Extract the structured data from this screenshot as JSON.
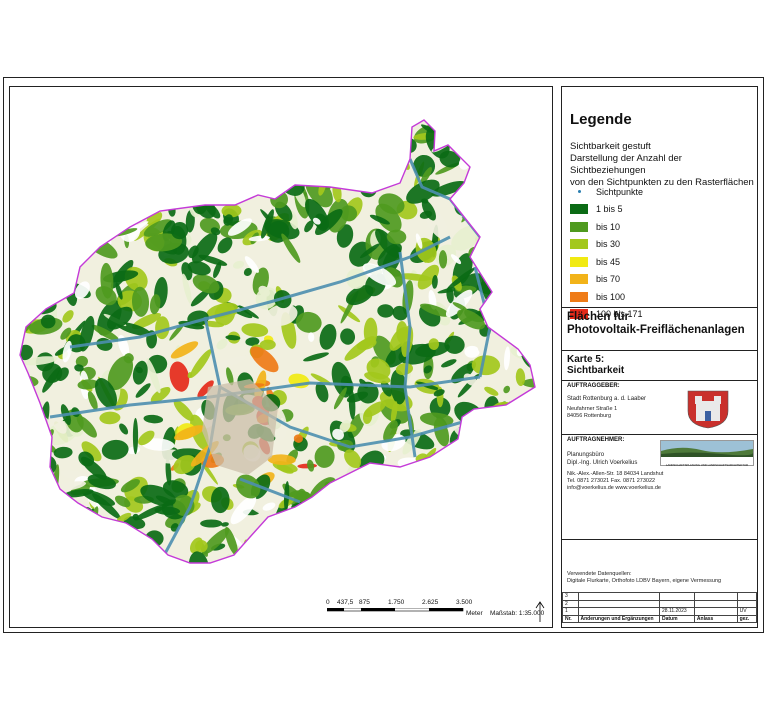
{
  "legend": {
    "title": "Legende",
    "subtitle_1": "Sichtbarkeit gestuft",
    "subtitle_2": "Darstellung der Anzahl der Sichtbeziehungen",
    "subtitle_3": "von den Sichtpunkten zu den Rasterflächen",
    "points_label": "Sichtpunkte",
    "classes": [
      {
        "label": "1 bis 5",
        "color": "#0b6b15"
      },
      {
        "label": "bis 10",
        "color": "#4f9a1f"
      },
      {
        "label": "bis 30",
        "color": "#a3c81c"
      },
      {
        "label": "bis 45",
        "color": "#f1ea12"
      },
      {
        "label": "bis 70",
        "color": "#f2b319"
      },
      {
        "label": "bis 100",
        "color": "#ef7b17"
      },
      {
        "label": "100 bis 171",
        "color": "#e52a1a"
      }
    ]
  },
  "project": {
    "title_1": "Flächen für",
    "title_2": "Photovoltaik-Freiflächenanlagen"
  },
  "map_sheet": {
    "number": "Karte 5:",
    "name": "Sichtbarkeit"
  },
  "client": {
    "label": "AUFTRAGGEBER:",
    "name": "Stadt Rottenburg a. d. Laaber",
    "street": "Neufahrner Straße 1",
    "city": "84056 Rottenburg"
  },
  "contractor": {
    "label": "AUFTRAGNEHMER:",
    "name_1": "Planungsbüro",
    "name_2": "Dipl.-Ing. Ulrich Voerkelius",
    "address": "Nik.-Alex.-Allen-Str. 18 84034 Landshut",
    "phone": "Tel. 0871 273021   Fax. 0871 273022",
    "web": "info@voerkelius.de   www.voerkelius.de",
    "logo_caption": "LANDSCHAFTSPLANUNG UND LANDSCHAFTSARCHITEKTUR"
  },
  "sources": {
    "label": "Verwendete Datenquellen:",
    "text": "Digitale Flurkarte,  Orthofoto LDBV Bayern, eigene Vermessung"
  },
  "revisions": {
    "rows": [
      {
        "no": "3",
        "text": "",
        "date": "",
        "reason": "",
        "by": ""
      },
      {
        "no": "2",
        "text": "",
        "date": "",
        "reason": "",
        "by": ""
      },
      {
        "no": "1",
        "text": "",
        "date": "28.11.2023",
        "reason": "",
        "by": "UV"
      }
    ],
    "header": {
      "no": "Nr.",
      "text": "Änderungen und Ergänzungen",
      "date": "Datum",
      "reason": "Anlass",
      "by": "gez."
    }
  },
  "scale": {
    "ticks": [
      "0",
      "437,5",
      "875",
      "1.750",
      "2.625",
      "3.500"
    ],
    "unit": "Meter",
    "ratio": "Maßstab: 1:35.000"
  }
}
